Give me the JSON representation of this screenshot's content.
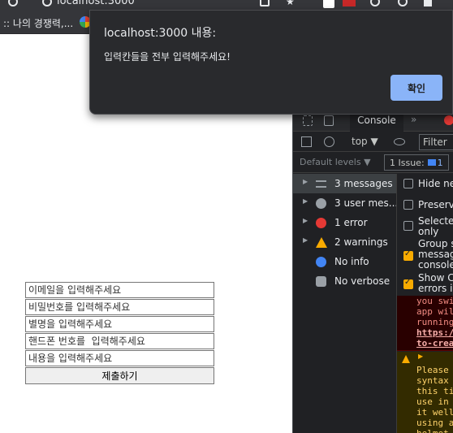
{
  "browser": {
    "address": "localhost:3000",
    "bookmarks": [
      ":: 나의 경쟁력,..."
    ]
  },
  "form": {
    "email_placeholder": "이메일을 입력해주세요",
    "password_placeholder": "비밀번호를 입력해주세요",
    "nickname_placeholder": "별명을 입력해주세요",
    "phone_placeholder": "핸드폰 번호를  입력해주세요",
    "content_placeholder": "내용을 입력해주세요",
    "submit_label": "제출하기"
  },
  "alert": {
    "title": "localhost:3000 내용:",
    "message": "입력칸들을 전부 입력해주세요!",
    "ok_label": "확인"
  },
  "devtools": {
    "active_tab": "Console",
    "more_tabs": "»",
    "context": "top ▼",
    "filter_placeholder": "Filter",
    "levels_label": "Default levels ▼",
    "issues_label": "1 Issue:",
    "issues_count": "1",
    "sidebar": [
      {
        "label": "3 messages",
        "icon": "list-icon"
      },
      {
        "label": "3 user mes...",
        "icon": "user-icon"
      },
      {
        "label": "1 error",
        "icon": "error-icon"
      },
      {
        "label": "2 warnings",
        "icon": "warning-icon"
      },
      {
        "label": "No info",
        "icon": "info-icon"
      },
      {
        "label": "No verbose",
        "icon": "verbose-icon"
      }
    ],
    "settings": [
      {
        "label": "Hide net",
        "checked": false
      },
      {
        "label": "Preserve",
        "checked": false
      },
      {
        "label": "Selected\nonly",
        "checked": false
      },
      {
        "label": "Group si\nmessage\nconsole",
        "checked": true
      },
      {
        "label": "Show CO\nerrors in",
        "checked": true
      }
    ],
    "error_log": [
      "you swi",
      "app wil",
      "running",
      "https://",
      "to-crea"
    ],
    "warning_log": [
      "Please",
      "syntax",
      "this ti",
      "use in",
      "it well",
      "using a",
      "helmet"
    ],
    "colors": {
      "error_bg": "#290000",
      "warning_bg": "#332b00",
      "accent": "#8ab4f8"
    }
  }
}
